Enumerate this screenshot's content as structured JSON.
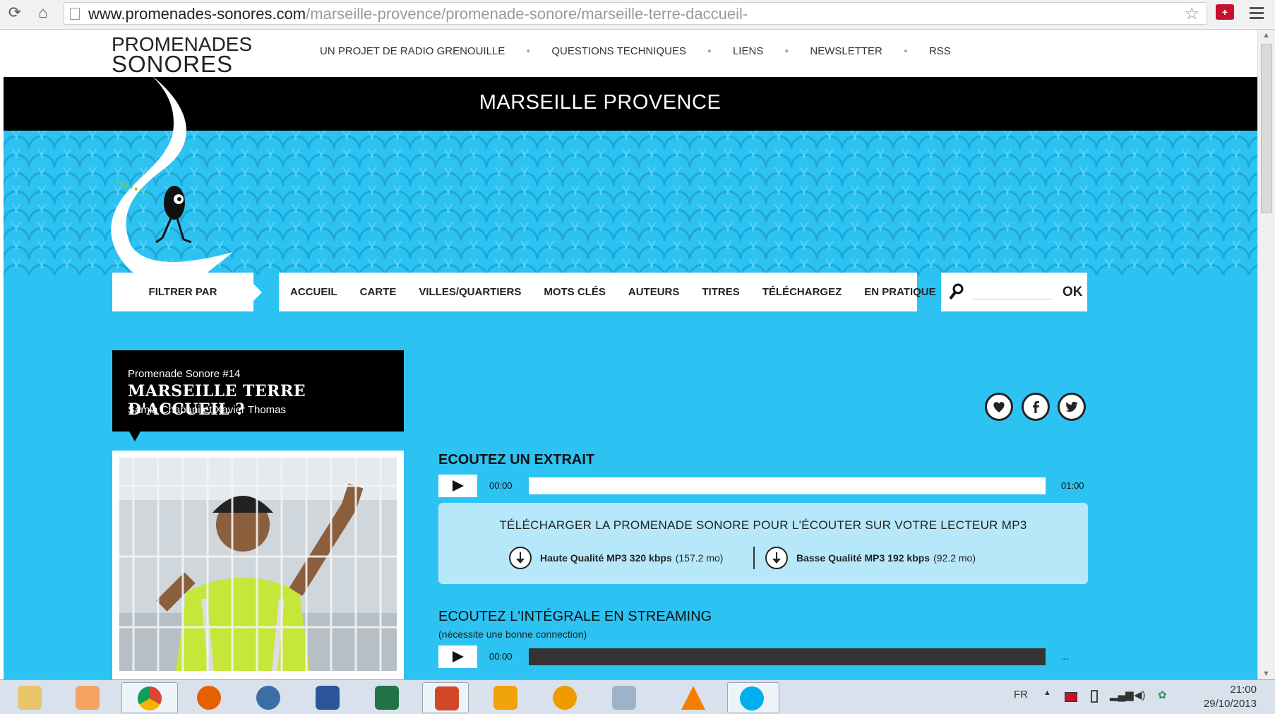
{
  "browser": {
    "url_host": "www.promenades-sonores.com",
    "url_path": "/marseille-provence/promenade-sonore/marseille-terre-daccueil-"
  },
  "site": {
    "logo_line1": "PROMENADES",
    "logo_line2": "SONORES",
    "top_links": [
      "UN PROJET DE RADIO GRENOUILLE",
      "QUESTIONS TECHNIQUES",
      "LIENS",
      "NEWSLETTER",
      "RSS"
    ],
    "region_title": "MARSEILLE PROVENCE"
  },
  "filter": {
    "label": "FILTRER PAR",
    "menu": [
      "ACCUEIL",
      "CARTE",
      "VILLES/QUARTIERS",
      "MOTS CLÉS",
      "AUTEURS",
      "TITRES",
      "TÉLÉCHARGEZ",
      "EN PRATIQUE"
    ],
    "search_value": "",
    "search_ok": "OK"
  },
  "promenade": {
    "number": "Promenade Sonore #14",
    "title": "MARSEILLE TERRE D'ACCUEIL ?",
    "authors": "Samia Chabani et Xavier Thomas"
  },
  "extrait": {
    "heading": "ECOUTEZ UN EXTRAIT",
    "time_current": "00:00",
    "time_total": "01:00"
  },
  "download": {
    "heading": "TÉLÉCHARGER LA PROMENADE SONORE POUR L'ÉCOUTER SUR VOTRE LECTEUR MP3",
    "hq_label": "Haute Qualité MP3 320 kbps",
    "hq_size": "(157.2 mo)",
    "lq_label": "Basse Qualité MP3 192 kbps",
    "lq_size": "(92.2 mo)"
  },
  "streaming": {
    "heading": "ECOUTEZ L'INTÉGRALE EN STREAMING",
    "subheading": "(nécessite une bonne connection)",
    "time_current": "00:00",
    "time_total": "..."
  },
  "taskbar": {
    "apps": [
      "explorer-icon",
      "media-player-icon",
      "chrome-icon",
      "firefox-icon",
      "thunderbird-icon",
      "word-icon",
      "excel-icon",
      "powerpoint-icon",
      "outlook-icon",
      "paint-icon",
      "calculator-icon",
      "vlc-icon",
      "skype-icon"
    ],
    "lang": "FR",
    "time": "21:00",
    "date": "29/10/2013"
  },
  "colors": {
    "page_bg": "#2cc3f3",
    "band": "#000000"
  }
}
